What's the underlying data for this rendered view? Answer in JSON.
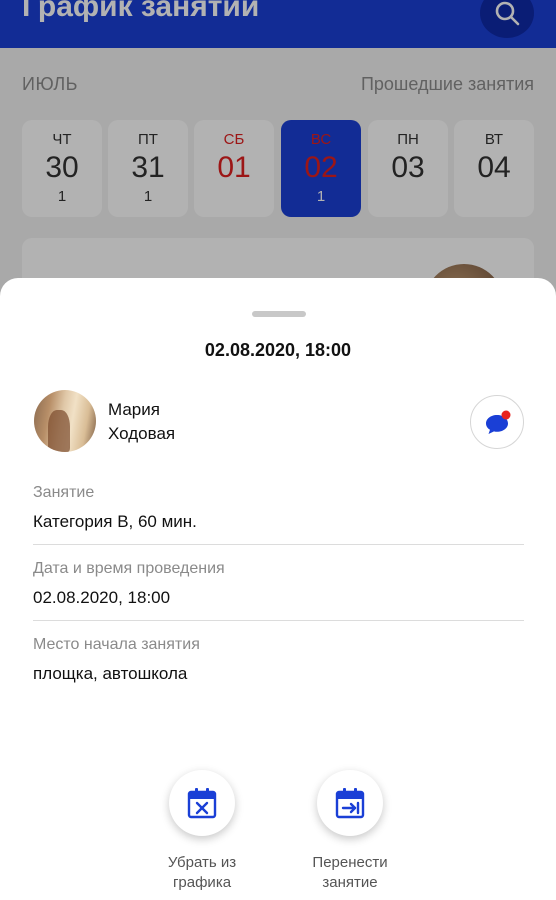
{
  "header": {
    "title": "График занятий"
  },
  "schedule": {
    "month": "ИЮЛЬ",
    "past_link": "Прошедшие занятия",
    "days": [
      {
        "dow": "ЧТ",
        "num": "30",
        "count": "1"
      },
      {
        "dow": "ПТ",
        "num": "31",
        "count": "1"
      },
      {
        "dow": "СБ",
        "num": "01",
        "count": ""
      },
      {
        "dow": "ВС",
        "num": "02",
        "count": "1"
      },
      {
        "dow": "ПН",
        "num": "03",
        "count": ""
      },
      {
        "dow": "ВТ",
        "num": "04",
        "count": ""
      }
    ]
  },
  "sheet": {
    "datetime": "02.08.2020, 18:00",
    "teacher": {
      "first_name": "Мария",
      "last_name": "Ходовая"
    },
    "fields": [
      {
        "label": "Занятие",
        "value": "Категория B, 60 мин."
      },
      {
        "label": "Дата и время проведения",
        "value": "02.08.2020, 18:00"
      },
      {
        "label": "Место начала занятия",
        "value": "площка, автошкола"
      }
    ],
    "actions": {
      "remove": {
        "line1": "Убрать из",
        "line2": "графика"
      },
      "move": {
        "line1": "Перенести",
        "line2": "занятие"
      }
    }
  },
  "colors": {
    "brand": "#1a3fd6",
    "weekend": "#e02020",
    "notification_dot": "#e8231f"
  },
  "icons": [
    "search-icon",
    "chat-icon",
    "calendar-remove-icon",
    "calendar-move-icon"
  ]
}
